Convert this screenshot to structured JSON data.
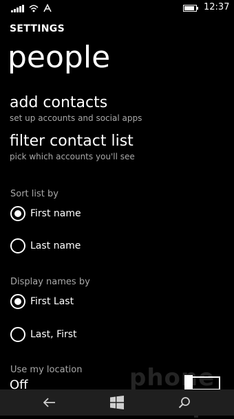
{
  "status_bar": {
    "time": "12:37",
    "battery_level": 0.85,
    "icons": [
      "signal-icon",
      "wifi-icon",
      "data-sense-icon",
      "battery-icon"
    ]
  },
  "header": {
    "app_name": "SETTINGS",
    "page_title": "people"
  },
  "links": [
    {
      "title": "add contacts",
      "subtitle": "set up accounts and social apps"
    },
    {
      "title": "filter contact list",
      "subtitle": "pick which accounts you'll see"
    }
  ],
  "sort_list": {
    "label": "Sort list by",
    "options": [
      {
        "label": "First name",
        "selected": true
      },
      {
        "label": "Last name",
        "selected": false
      }
    ]
  },
  "display_names": {
    "label": "Display names by",
    "options": [
      {
        "label": "First Last",
        "selected": true
      },
      {
        "label": "Last, First",
        "selected": false
      }
    ]
  },
  "location": {
    "label": "Use my location",
    "value": "Off",
    "enabled": false
  },
  "watermark": "phone scoop",
  "nav_bar": {
    "icons": [
      "back-icon",
      "windows-start-icon",
      "search-icon"
    ]
  }
}
